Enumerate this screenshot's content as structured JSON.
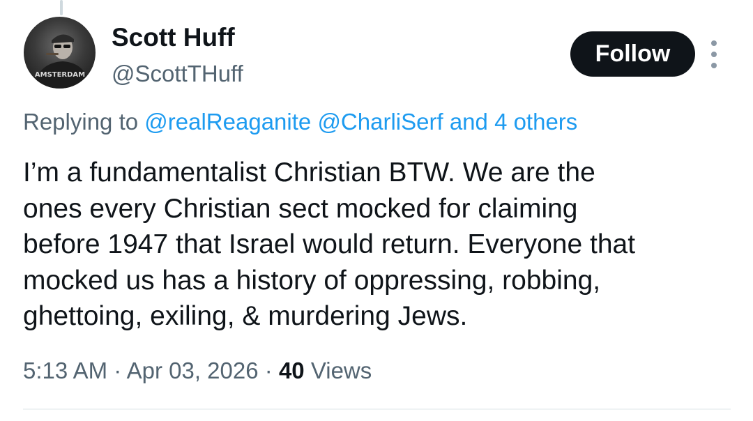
{
  "author": {
    "display_name": "Scott Huff",
    "handle": "@ScottTHuff",
    "avatar_text": "AMSTERDAM"
  },
  "follow_label": "Follow",
  "reply": {
    "prefix": "Replying to",
    "mentions": [
      "@realReaganite",
      "@CharliSerf"
    ],
    "connector": "and",
    "others": "4 others"
  },
  "tweet": {
    "lines": [
      "I’m a fundamentalist Christian BTW. We are the",
      "ones every Christian sect mocked for claiming",
      "before 1947 that Israel would return. Everyone that",
      "mocked us has a history of oppressing, robbing,",
      "ghettoing, exiling, & murdering Jews."
    ]
  },
  "meta": {
    "time": "5:13 AM",
    "separator": "·",
    "date": "Apr 03, 2026",
    "views_count": "40",
    "views_label": "Views"
  },
  "colors": {
    "text": "#0f1419",
    "secondary": "#536471",
    "link": "#1d9bf0",
    "button_bg": "#0f1419"
  },
  "icons": {
    "more": "more-vertical-icon"
  }
}
